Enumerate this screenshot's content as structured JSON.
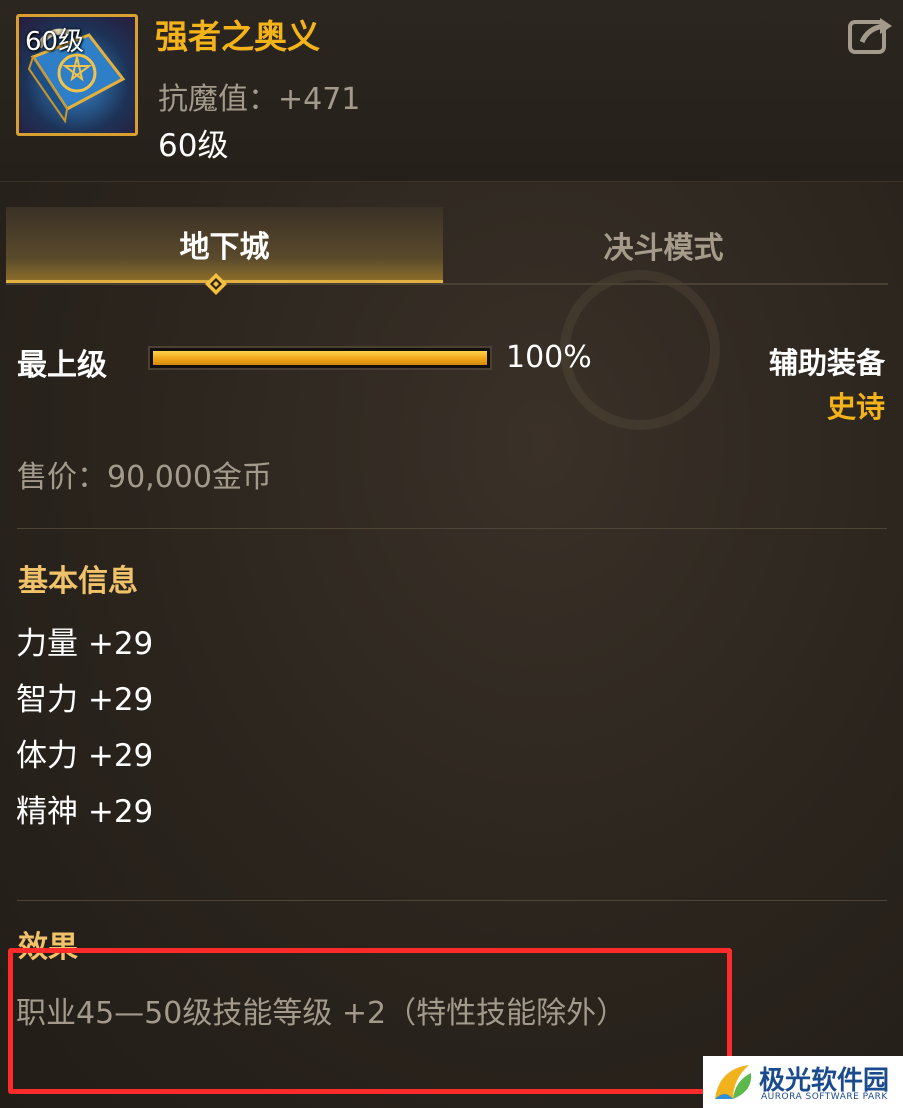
{
  "item": {
    "icon_level": "60级",
    "name": "强者之奥义",
    "stat": "抗魔值：+471",
    "level": "60级"
  },
  "header": {
    "share_icon": "share-icon"
  },
  "tabs": [
    {
      "label": "地下城",
      "active": true
    },
    {
      "label": "决斗模式",
      "active": false
    }
  ],
  "upgrade": {
    "label": "最上级",
    "progress_text": "100%",
    "progress_fraction": 1.0
  },
  "equipment": {
    "type": "辅助装备",
    "rarity": "史诗"
  },
  "price": "售价：90,000金币",
  "basic_info": {
    "title": "基本信息",
    "stats": [
      "力量 +29",
      "智力 +29",
      "体力 +29",
      "精神 +29"
    ]
  },
  "effect": {
    "title": "效果",
    "text": "职业45—50级技能等级 +2（特性技能除外）"
  },
  "watermark": {
    "title": "极光软件园",
    "subtitle": "AURORA SOFTWARE PARK"
  },
  "colors": {
    "gold": "#f5b31a",
    "highlight": "#ff2a2a"
  }
}
